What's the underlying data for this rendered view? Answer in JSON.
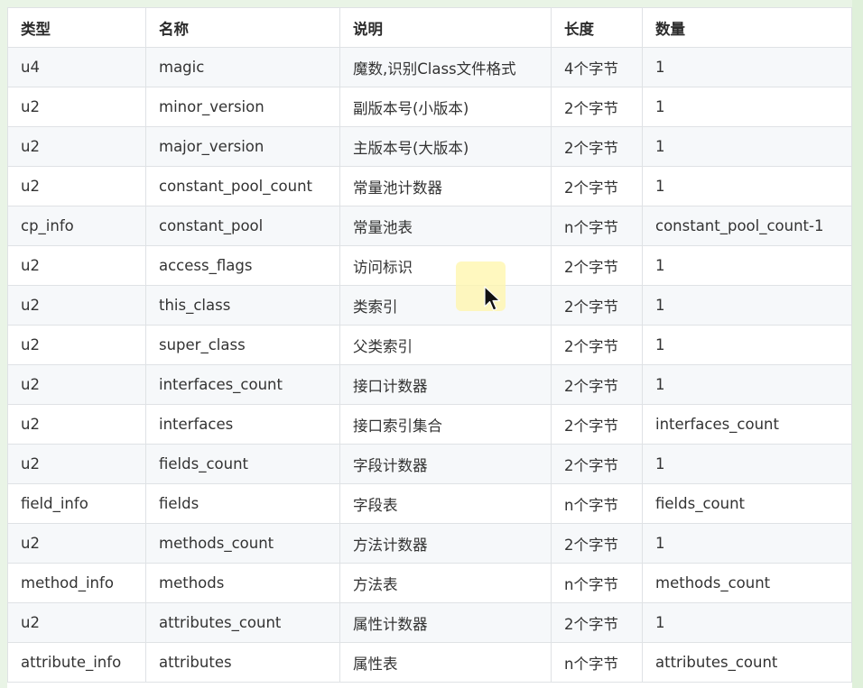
{
  "table": {
    "headers": [
      "类型",
      "名称",
      "说明",
      "长度",
      "数量"
    ],
    "rows": [
      [
        "u4",
        "magic",
        "魔数,识别Class文件格式",
        "4个字节",
        "1"
      ],
      [
        "u2",
        "minor_version",
        "副版本号(小版本)",
        "2个字节",
        "1"
      ],
      [
        "u2",
        "major_version",
        "主版本号(大版本)",
        "2个字节",
        "1"
      ],
      [
        "u2",
        "constant_pool_count",
        "常量池计数器",
        "2个字节",
        "1"
      ],
      [
        "cp_info",
        "constant_pool",
        "常量池表",
        "n个字节",
        "constant_pool_count-1"
      ],
      [
        "u2",
        "access_flags",
        "访问标识",
        "2个字节",
        "1"
      ],
      [
        "u2",
        "this_class",
        "类索引",
        "2个字节",
        "1"
      ],
      [
        "u2",
        "super_class",
        "父类索引",
        "2个字节",
        "1"
      ],
      [
        "u2",
        "interfaces_count",
        "接口计数器",
        "2个字节",
        "1"
      ],
      [
        "u2",
        "interfaces",
        "接口索引集合",
        "2个字节",
        "interfaces_count"
      ],
      [
        "u2",
        "fields_count",
        "字段计数器",
        "2个字节",
        "1"
      ],
      [
        "field_info",
        "fields",
        "字段表",
        "n个字节",
        "fields_count"
      ],
      [
        "u2",
        "methods_count",
        "方法计数器",
        "2个字节",
        "1"
      ],
      [
        "method_info",
        "methods",
        "方法表",
        "n个字节",
        "methods_count"
      ],
      [
        "u2",
        "attributes_count",
        "属性计数器",
        "2个字节",
        "1"
      ],
      [
        "attribute_info",
        "attributes",
        "属性表",
        "n个字节",
        "attributes_count"
      ]
    ]
  },
  "cursor": {
    "icon": "mouse-pointer-icon",
    "highlight_color": "#fff5aa"
  }
}
